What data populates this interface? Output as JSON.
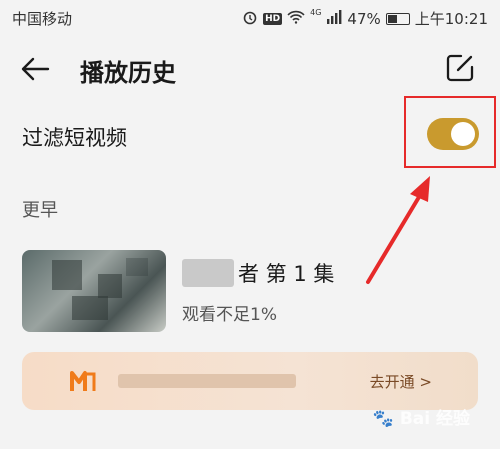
{
  "status_bar": {
    "carrier": "中国移动",
    "hd": "HD",
    "network": "4G",
    "battery": "47%",
    "battery_level": 0.47,
    "time": "上午10:21"
  },
  "header": {
    "title": "播放历史"
  },
  "filter": {
    "label": "过滤短视频",
    "enabled": true
  },
  "section": {
    "label": "更早"
  },
  "history_items": [
    {
      "title": "者 第 1 集",
      "progress": "观看不足1%"
    }
  ],
  "vip_banner": {
    "action": "去开通 >"
  },
  "watermark": {
    "text": "Bai 经验"
  },
  "colors": {
    "toggle_on": "#c99a2e",
    "highlight": "#e62a2a",
    "banner_bg": "#f6dcc7",
    "banner_text": "#7a4a26",
    "logo": "#f07b1a"
  }
}
